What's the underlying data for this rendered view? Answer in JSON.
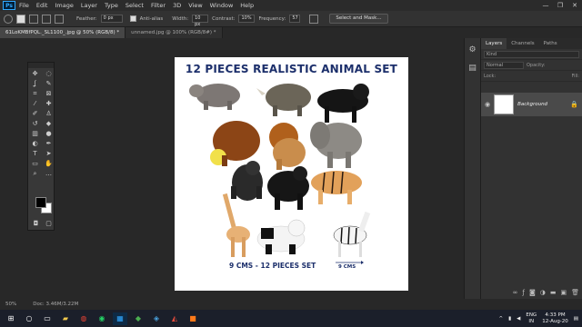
{
  "menu": {
    "logo": "Ps",
    "items": [
      "File",
      "Edit",
      "Image",
      "Layer",
      "Type",
      "Select",
      "Filter",
      "3D",
      "View",
      "Window",
      "Help"
    ]
  },
  "window_controls": {
    "minimize": "—",
    "maximize": "❐",
    "close": "✕"
  },
  "options": {
    "feather_label": "Feather:",
    "feather_value": "0 px",
    "antialias_label": "Anti-alias",
    "width_label": "Width:",
    "width_value": "10 px",
    "contrast_label": "Contrast:",
    "contrast_value": "10%",
    "frequency_label": "Frequency:",
    "frequency_value": "57",
    "select_mask_button": "Select and Mask..."
  },
  "tabs": [
    {
      "label": "61LoKMBfPQL._SL1100_.jpg @ 50% (RGB/8) *",
      "active": true
    },
    {
      "label": "unnamed.jpg @ 100% (RGB/8#) *",
      "active": false
    }
  ],
  "document": {
    "title": "12 PIECES REALISTIC ANIMAL  SET",
    "footer": "9 CMS - 12 PIECES SET",
    "scale_label": "9 CMS"
  },
  "layers_panel": {
    "tabs": [
      "Layers",
      "Channels",
      "Paths"
    ],
    "kind_placeholder": "Kind",
    "blend_mode": "Normal",
    "opacity_label": "Opacity:",
    "lock_label": "Lock:",
    "fill_label": "Fill:",
    "layer_name": "Background"
  },
  "status": {
    "zoom": "50%",
    "doc_size": "Doc: 3.46M/3.22M"
  },
  "taskbar": {
    "lang_line1": "ENG",
    "lang_line2": "IN",
    "time": "4:33 PM",
    "date": "12-Aug-20"
  },
  "colors": {
    "title_navy": "#1c2f6b",
    "ps_blue": "#31a8ff"
  }
}
